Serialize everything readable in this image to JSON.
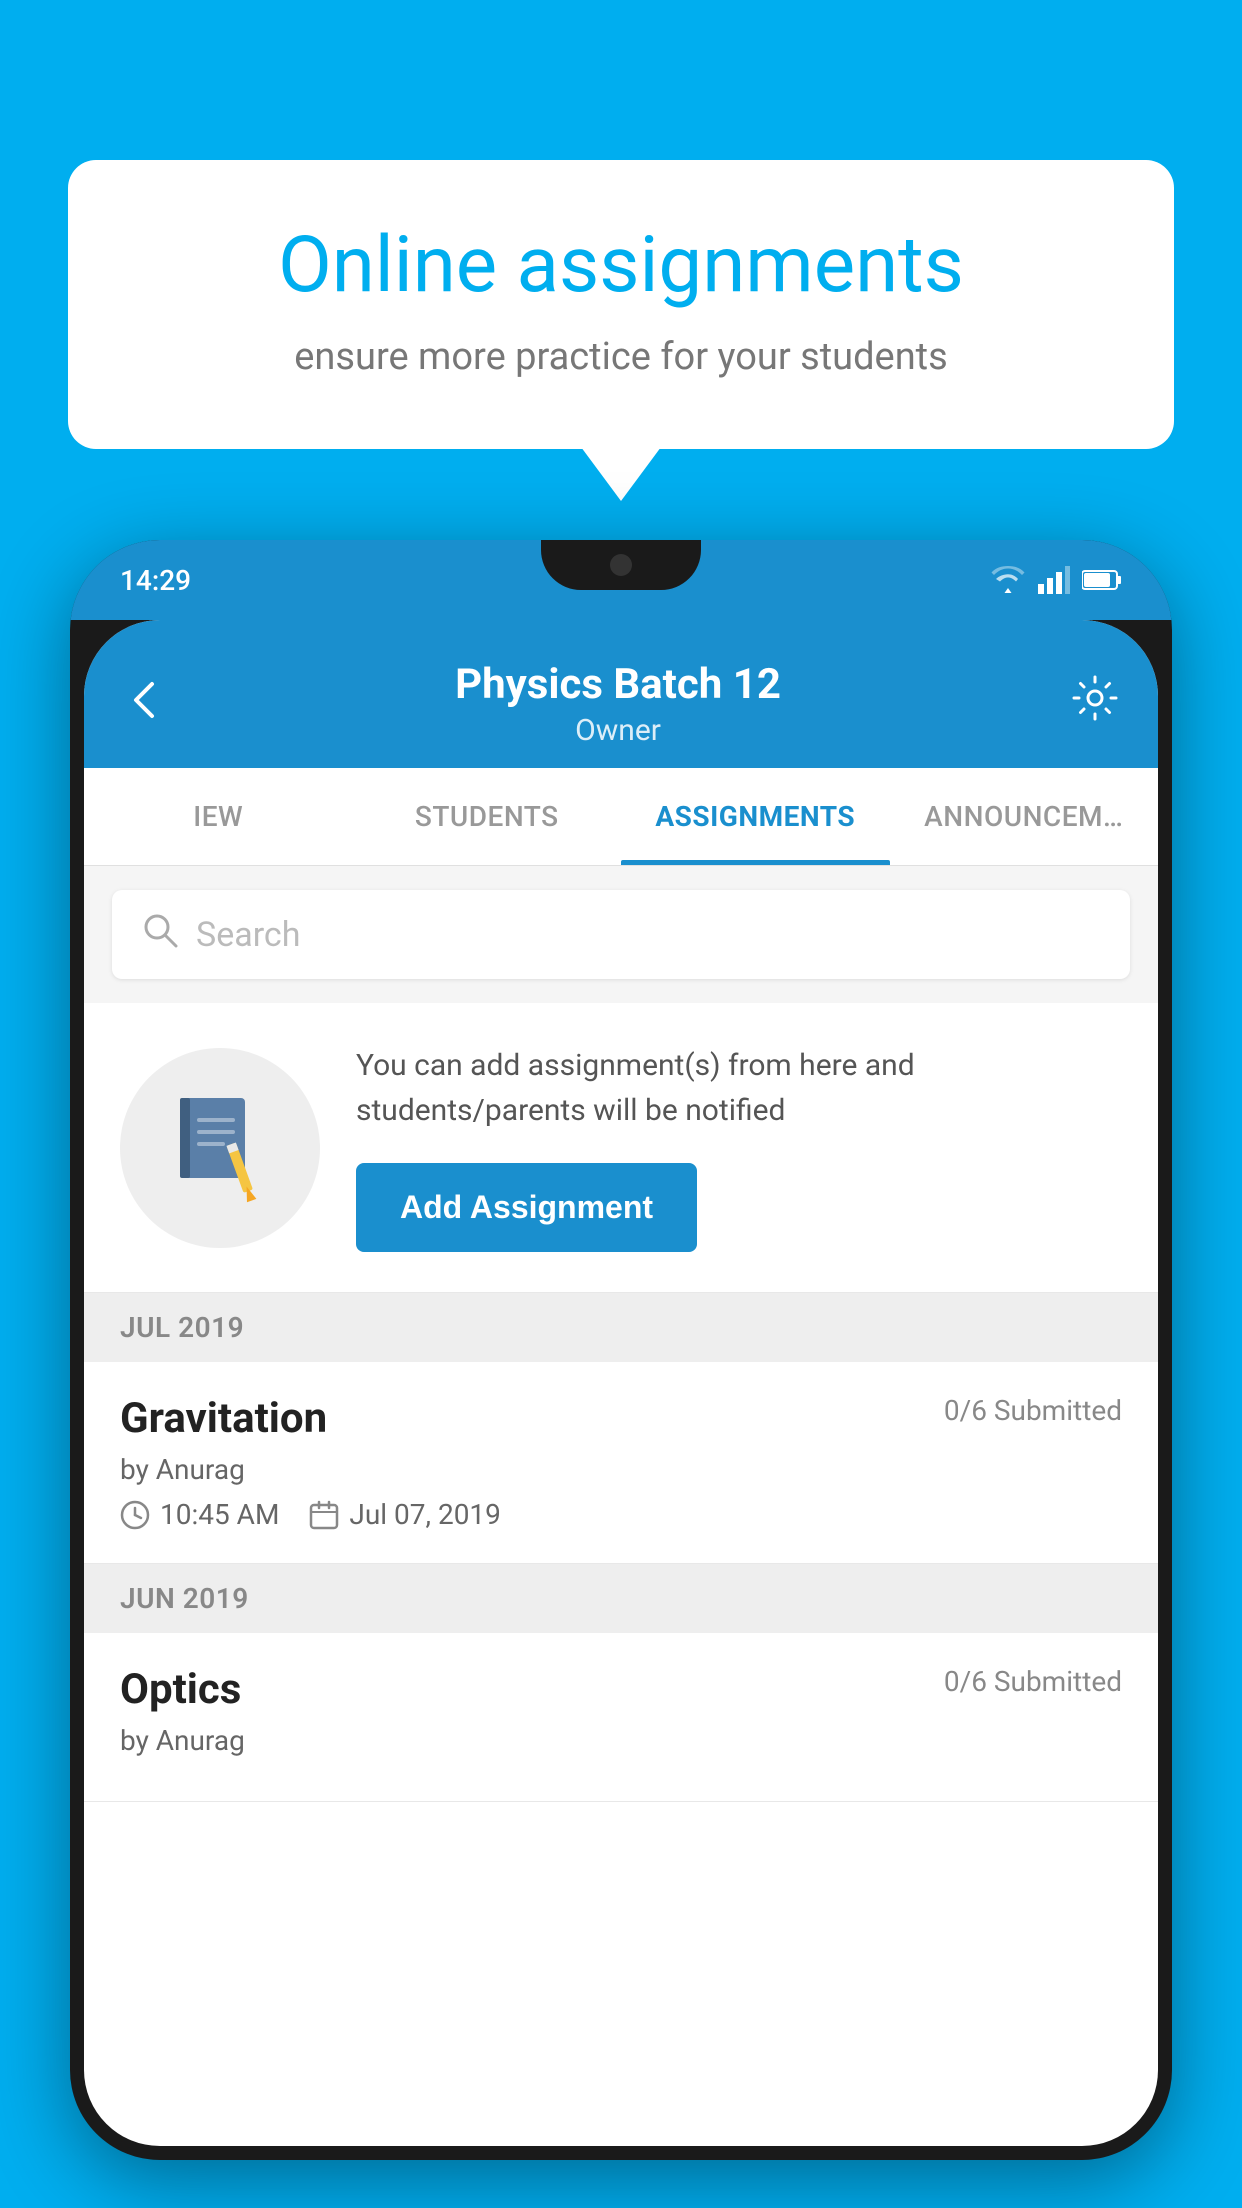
{
  "background_color": "#00AEEF",
  "speech_bubble": {
    "title": "Online assignments",
    "subtitle": "ensure more practice for your students"
  },
  "phone": {
    "status_bar": {
      "time": "14:29",
      "icons": [
        "wifi",
        "signal",
        "battery"
      ]
    },
    "header": {
      "title": "Physics Batch 12",
      "subtitle": "Owner",
      "back_label": "←",
      "settings_label": "⚙"
    },
    "tabs": [
      {
        "label": "IEW",
        "active": false
      },
      {
        "label": "STUDENTS",
        "active": false
      },
      {
        "label": "ASSIGNMENTS",
        "active": true
      },
      {
        "label": "ANNOUNCEM…",
        "active": false
      }
    ],
    "search": {
      "placeholder": "Search"
    },
    "info_card": {
      "text": "You can add assignment(s) from here and students/parents will be notified",
      "button_label": "Add Assignment"
    },
    "sections": [
      {
        "month_label": "JUL 2019",
        "assignments": [
          {
            "name": "Gravitation",
            "submitted": "0/6 Submitted",
            "author": "by Anurag",
            "time": "10:45 AM",
            "date": "Jul 07, 2019"
          }
        ]
      },
      {
        "month_label": "JUN 2019",
        "assignments": [
          {
            "name": "Optics",
            "submitted": "0/6 Submitted",
            "author": "by Anurag",
            "time": "",
            "date": ""
          }
        ]
      }
    ]
  }
}
